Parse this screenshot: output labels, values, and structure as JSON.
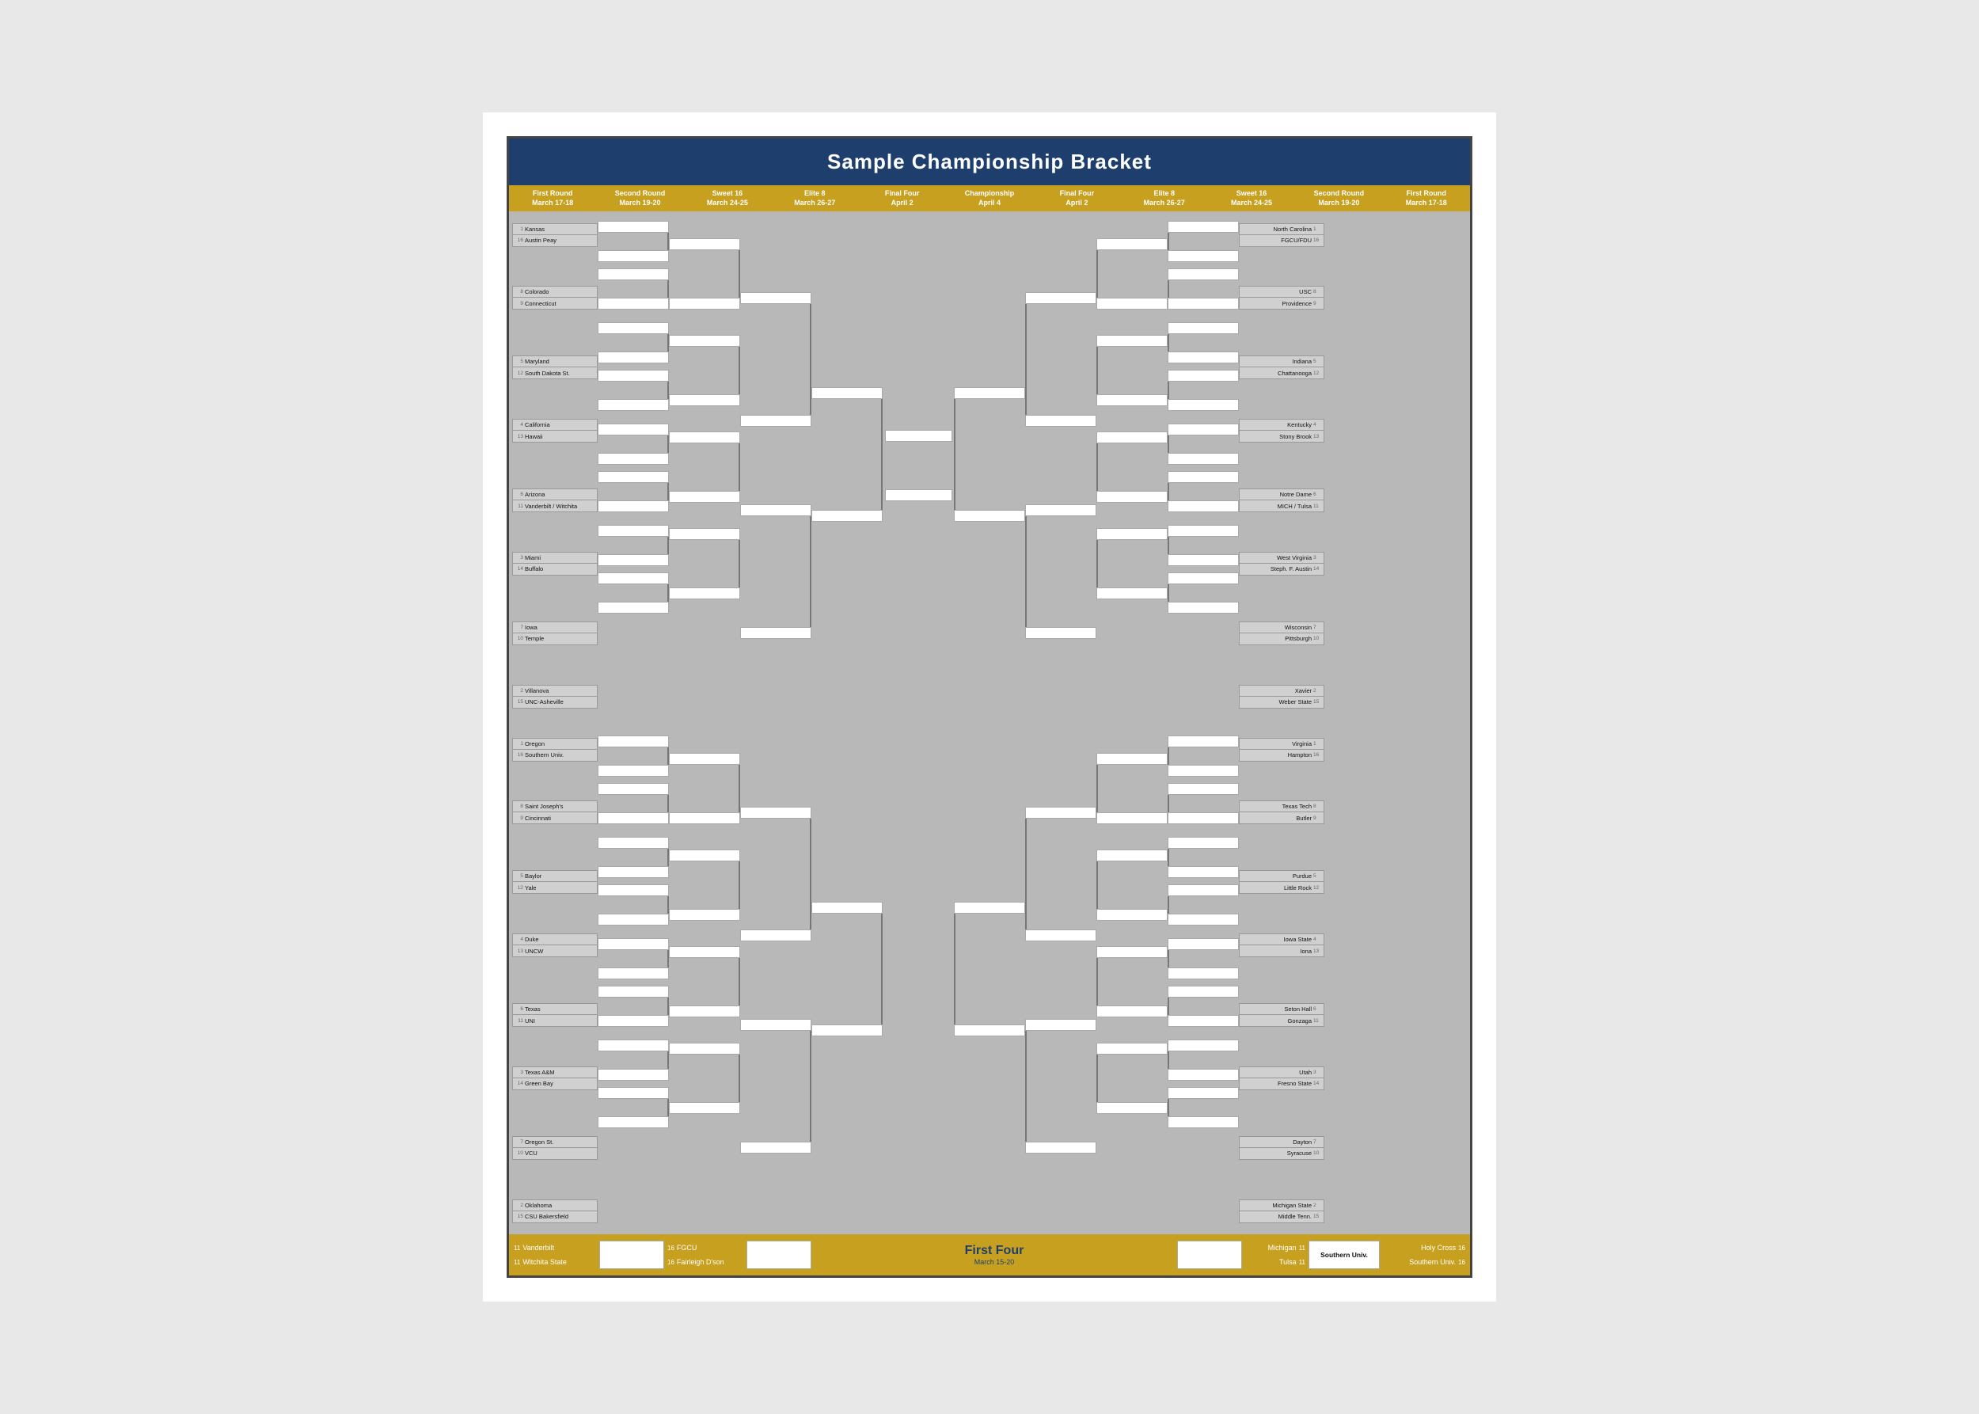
{
  "title": "Sample Championship Bracket",
  "rounds": {
    "left": [
      {
        "label": "First Round",
        "sub": "March 17-18"
      },
      {
        "label": "Second Round",
        "sub": "March 19-20"
      },
      {
        "label": "Sweet 16",
        "sub": "March 24-25"
      },
      {
        "label": "Elite 8",
        "sub": "March 26-27"
      },
      {
        "label": "Final Four",
        "sub": "April 2"
      },
      {
        "label": "Championship",
        "sub": "April 4"
      }
    ],
    "right": [
      {
        "label": "Final Four",
        "sub": "April 2"
      },
      {
        "label": "Elite 8",
        "sub": "March 26-27"
      },
      {
        "label": "Sweet 16",
        "sub": "March 24-25"
      },
      {
        "label": "Second Round",
        "sub": "March 19-20"
      },
      {
        "label": "First Round",
        "sub": "March 17-18"
      }
    ]
  },
  "left_region": {
    "r1": [
      [
        {
          "seed": 1,
          "name": "Kansas"
        },
        {
          "seed": 16,
          "name": "Austin Peay"
        }
      ],
      [
        {
          "seed": 8,
          "name": "Colorado"
        },
        {
          "seed": 9,
          "name": "Connecticut"
        }
      ],
      [
        {
          "seed": 5,
          "name": "Maryland"
        },
        {
          "seed": 12,
          "name": "South Dakota St."
        }
      ],
      [
        {
          "seed": 4,
          "name": "California"
        },
        {
          "seed": 13,
          "name": "Hawaii"
        }
      ],
      [
        {
          "seed": 6,
          "name": "Arizona"
        },
        {
          "seed": 11,
          "name": "Vanderbilt / Witchita"
        }
      ],
      [
        {
          "seed": 3,
          "name": "Miami"
        },
        {
          "seed": 14,
          "name": "Buffalo"
        }
      ],
      [
        {
          "seed": 7,
          "name": "Iowa"
        },
        {
          "seed": 10,
          "name": "Temple"
        }
      ],
      [
        {
          "seed": 2,
          "name": "Villanova"
        },
        {
          "seed": 15,
          "name": "UNC-Asheville"
        }
      ]
    ],
    "r2": [
      0,
      1,
      2,
      3,
      4,
      5,
      6,
      7
    ],
    "s16": [
      0,
      1,
      2,
      3
    ],
    "e8": [
      0,
      1
    ],
    "ff": [
      0
    ]
  },
  "right_region": {
    "r1": [
      [
        {
          "seed": 1,
          "name": "North Carolina"
        },
        {
          "seed": 16,
          "name": "FGCU/FDU"
        }
      ],
      [
        {
          "seed": 8,
          "name": "USC"
        },
        {
          "seed": 9,
          "name": "Providence"
        }
      ],
      [
        {
          "seed": 5,
          "name": "Indiana"
        },
        {
          "seed": 12,
          "name": "Chattanooga"
        }
      ],
      [
        {
          "seed": 4,
          "name": "Kentucky"
        },
        {
          "seed": 13,
          "name": "Stony Brook"
        }
      ],
      [
        {
          "seed": 6,
          "name": "Notre Dame"
        },
        {
          "seed": 11,
          "name": "MICH / Tulsa"
        }
      ],
      [
        {
          "seed": 3,
          "name": "West Virginia"
        },
        {
          "seed": 14,
          "name": "Steph. F. Austin"
        }
      ],
      [
        {
          "seed": 7,
          "name": "Wisconsin"
        },
        {
          "seed": 10,
          "name": "Pittsburgh"
        }
      ],
      [
        {
          "seed": 2,
          "name": "Xavier"
        },
        {
          "seed": 15,
          "name": "Weber State"
        }
      ]
    ]
  },
  "bottom_left_region": {
    "r1": [
      [
        {
          "seed": 1,
          "name": "Oregon"
        },
        {
          "seed": 16,
          "name": "Southern Univ."
        }
      ],
      [
        {
          "seed": 8,
          "name": "Saint Joseph's"
        },
        {
          "seed": 9,
          "name": "Cincinnati"
        }
      ],
      [
        {
          "seed": 5,
          "name": "Baylor"
        },
        {
          "seed": 12,
          "name": "Yale"
        }
      ],
      [
        {
          "seed": 4,
          "name": "Duke"
        },
        {
          "seed": 13,
          "name": "UNCW"
        }
      ],
      [
        {
          "seed": 6,
          "name": "Texas"
        },
        {
          "seed": 11,
          "name": "UNI"
        }
      ],
      [
        {
          "seed": 3,
          "name": "Texas A&M"
        },
        {
          "seed": 14,
          "name": "Green Bay"
        }
      ],
      [
        {
          "seed": 7,
          "name": "Oregon St."
        },
        {
          "seed": 10,
          "name": "VCU"
        }
      ],
      [
        {
          "seed": 2,
          "name": "Oklahoma"
        },
        {
          "seed": 15,
          "name": "CSU Bakersfield"
        }
      ]
    ]
  },
  "bottom_right_region": {
    "r1": [
      [
        {
          "seed": 1,
          "name": "Virginia"
        },
        {
          "seed": 16,
          "name": "Hampton"
        }
      ],
      [
        {
          "seed": 8,
          "name": "Texas Tech"
        },
        {
          "seed": 9,
          "name": "Butler"
        }
      ],
      [
        {
          "seed": 5,
          "name": "Purdue"
        },
        {
          "seed": 12,
          "name": "Little Rock"
        }
      ],
      [
        {
          "seed": 4,
          "name": "Iowa State"
        },
        {
          "seed": 13,
          "name": "Iona"
        }
      ],
      [
        {
          "seed": 6,
          "name": "Seton Hall"
        },
        {
          "seed": 11,
          "name": "Gonzaga"
        }
      ],
      [
        {
          "seed": 3,
          "name": "Utah"
        },
        {
          "seed": 14,
          "name": "Fresno State"
        }
      ],
      [
        {
          "seed": 7,
          "name": "Dayton"
        },
        {
          "seed": 10,
          "name": "Syracuse"
        }
      ],
      [
        {
          "seed": 2,
          "name": "Michigan State"
        },
        {
          "seed": 15,
          "name": "Middle Tenn."
        }
      ]
    ]
  },
  "first_four": {
    "label": "First Four",
    "sub": "March 15-20",
    "left_games": [
      [
        {
          "seed": 11,
          "name": "Vanderbilt"
        },
        {
          "seed": 11,
          "name": "Witchita State"
        }
      ],
      [
        {
          "seed": 16,
          "name": "FGCU"
        },
        {
          "seed": 16,
          "name": "Fairleigh D'son"
        }
      ]
    ],
    "right_games": [
      [
        {
          "seed": 11,
          "name": "Michigan"
        },
        {
          "seed": 11,
          "name": "Tulsa"
        }
      ],
      [
        {
          "name": "Southern Univ."
        }
      ]
    ],
    "holy_cross_game": [
      [
        {
          "seed": 16,
          "name": "Holy Cross"
        },
        {
          "seed": 16,
          "name": "Southern Univ."
        }
      ]
    ]
  },
  "colors": {
    "header_bg": "#1e3f6e",
    "round_bar_bg": "#c8a020",
    "bracket_bg": "#c0c0c0",
    "team_bg": "#d0d0d0",
    "adv_bg": "#ffffff"
  }
}
